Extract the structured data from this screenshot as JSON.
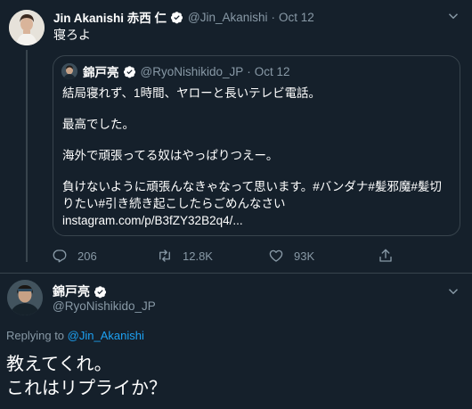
{
  "tweet": {
    "author_name": "Jin Akanishi 赤西 仁",
    "author_handle": "@Jin_Akanishi",
    "separator": "·",
    "date": "Oct 12",
    "text": "寝ろよ",
    "quote": {
      "author_name": "錦戸亮",
      "author_handle": "@RyoNishikido_JP",
      "separator": "·",
      "date": "Oct 12",
      "lines": [
        "結局寝れず、1時間、ヤローと長いテレビ電話。",
        "最高でした。",
        "海外で頑張ってる奴はやっぱりつえー。"
      ],
      "last_line_1": "負けないように頑張んなきゃなって思います。#バンダナ#髪邪魔#髪切",
      "last_line_2": "りたい#引き続き起こしたらごめんなさい",
      "link": "instagram.com/p/B3fZY32B2q4/..."
    },
    "stats": {
      "replies": "206",
      "retweets": "12.8K",
      "likes": "93K"
    }
  },
  "reply": {
    "author_name": "錦戸亮",
    "author_handle": "@RyoNishikido_JP",
    "replying_prefix": "Replying to",
    "replying_to": "@Jin_Akanishi",
    "line1": "教えてくれ。",
    "line2": "これはリプライか？"
  },
  "colors": {
    "background": "#15202b",
    "border": "#38444d",
    "secondary_text": "#8899a6",
    "accent": "#1da1f2"
  }
}
